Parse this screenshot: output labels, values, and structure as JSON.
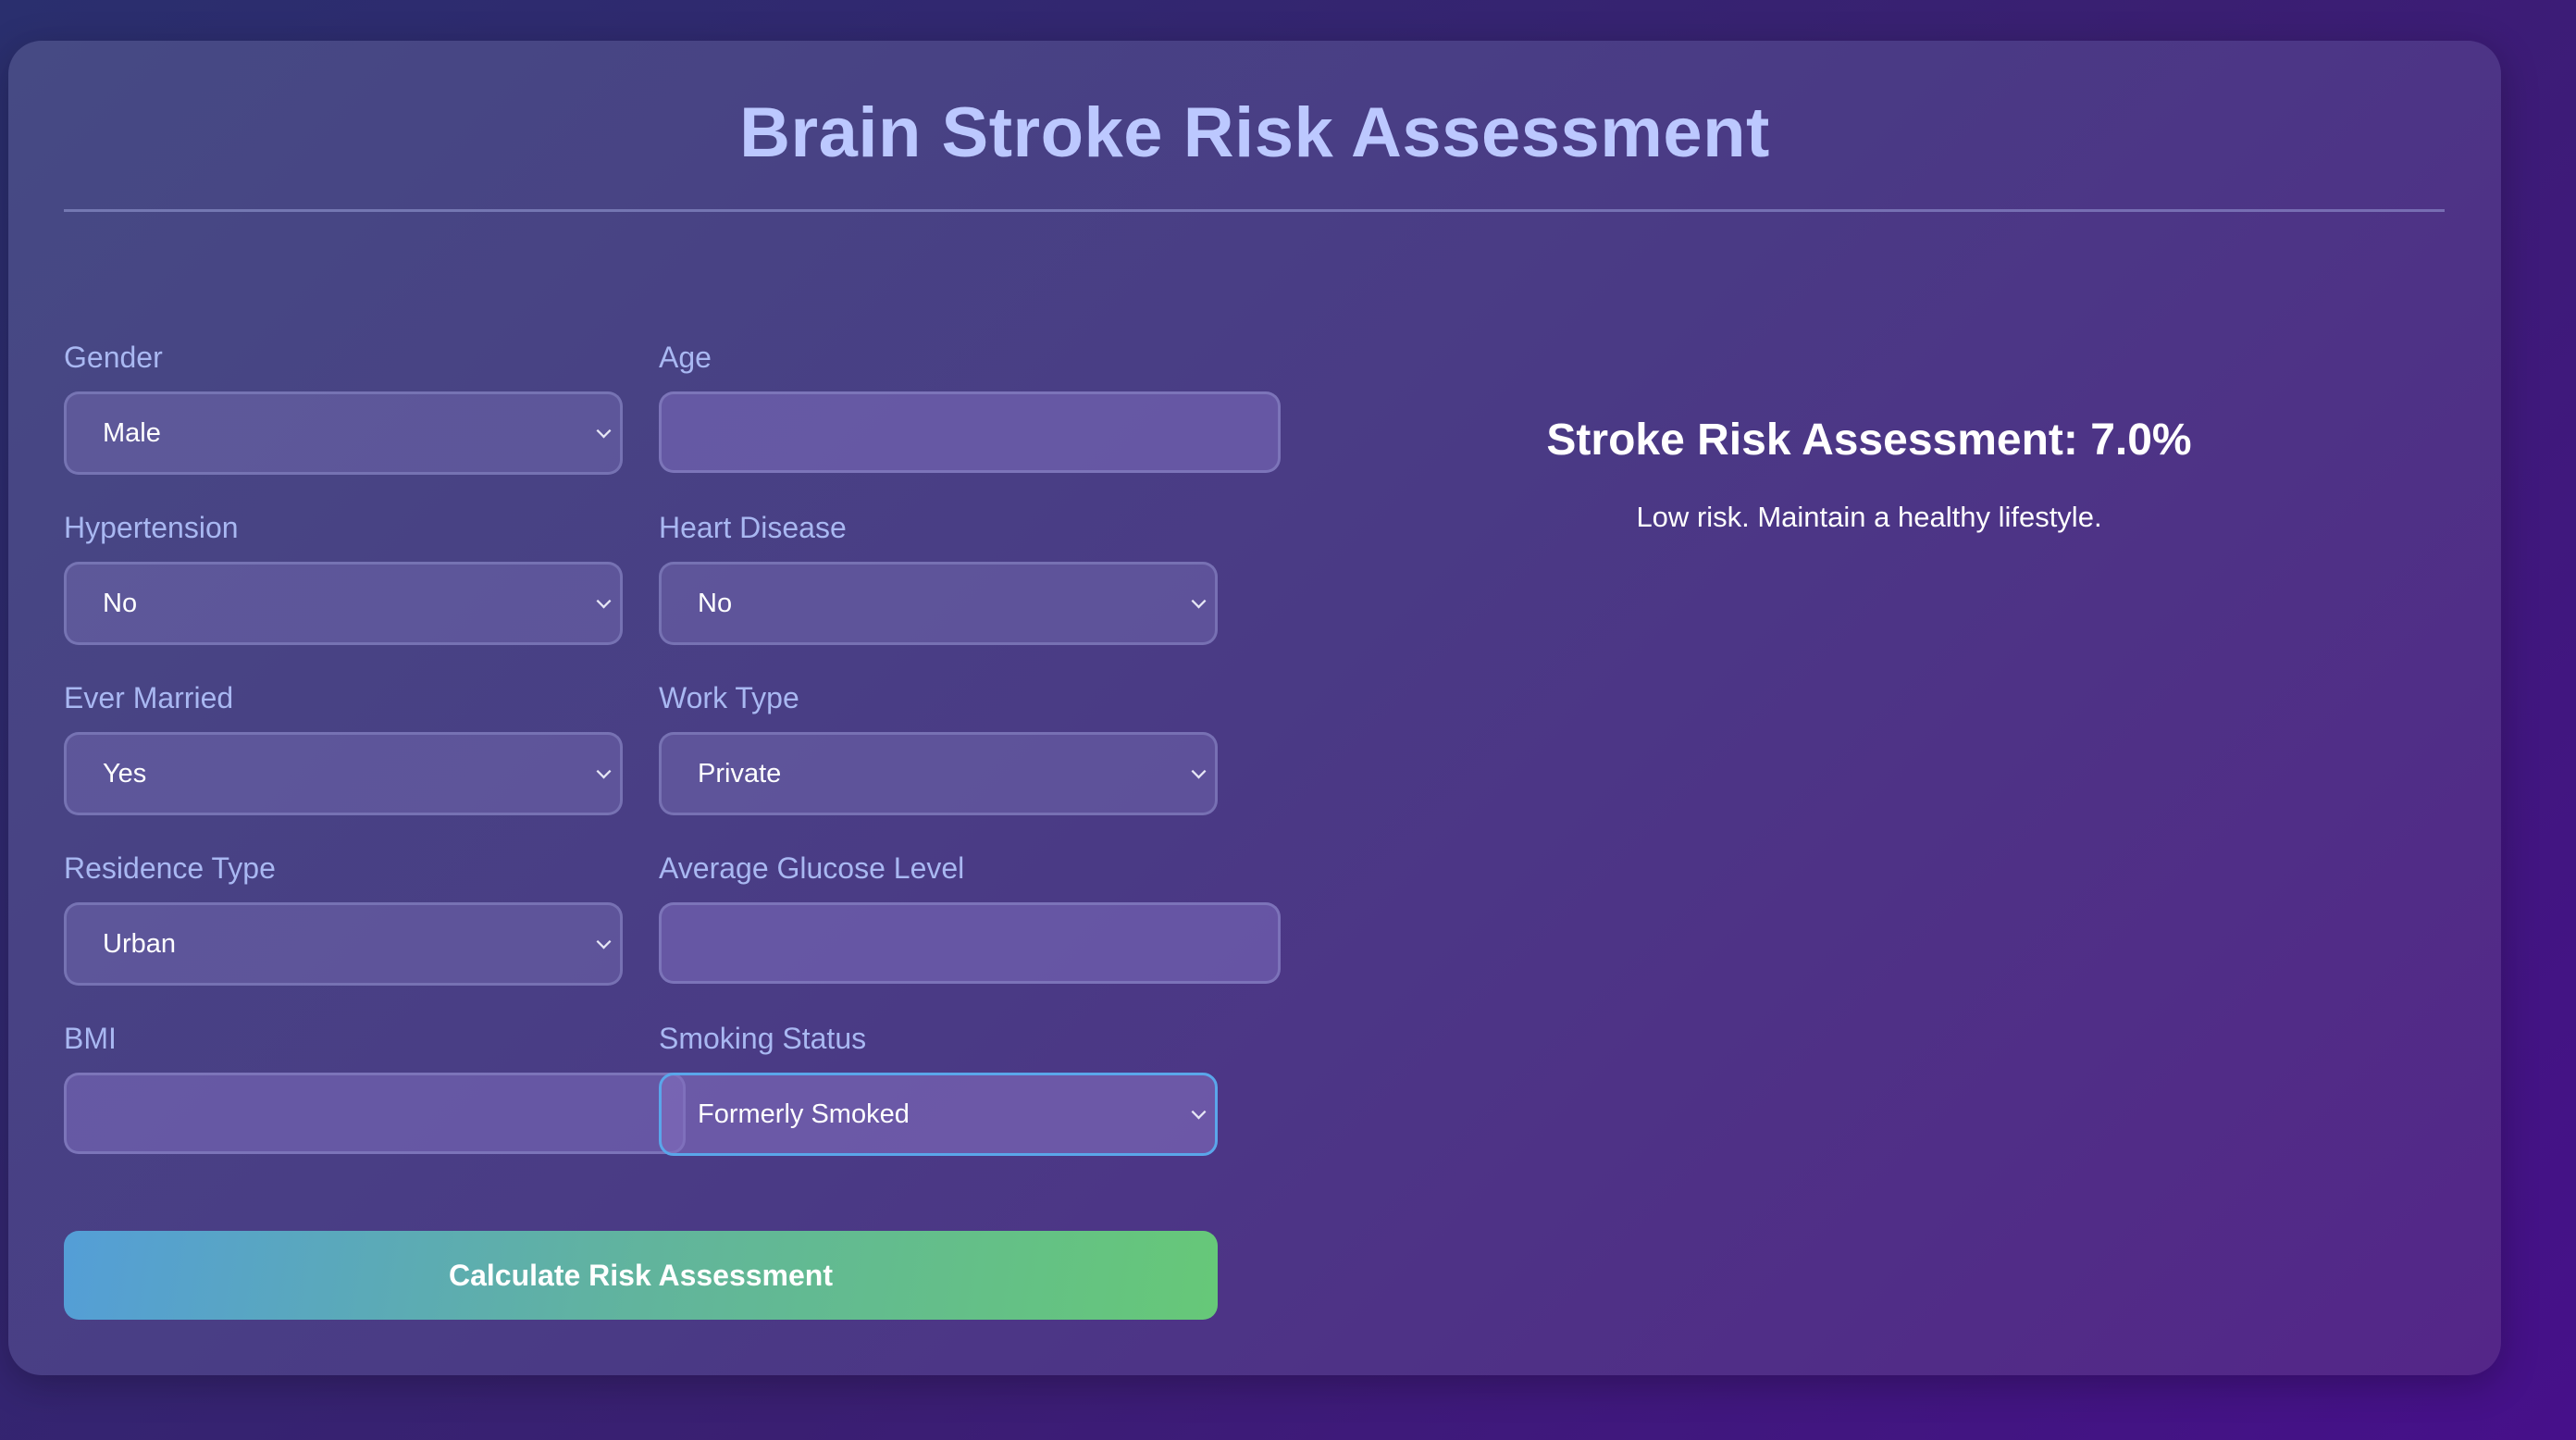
{
  "page": {
    "title": "Brain Stroke Risk Assessment"
  },
  "form": {
    "gender": {
      "label": "Gender",
      "value": "Male"
    },
    "age": {
      "label": "Age",
      "value": ""
    },
    "hypertension": {
      "label": "Hypertension",
      "value": "No"
    },
    "heart_disease": {
      "label": "Heart Disease",
      "value": "No"
    },
    "ever_married": {
      "label": "Ever Married",
      "value": "Yes"
    },
    "work_type": {
      "label": "Work Type",
      "value": "Private"
    },
    "residence_type": {
      "label": "Residence Type",
      "value": "Urban"
    },
    "avg_glucose": {
      "label": "Average Glucose Level",
      "value": ""
    },
    "bmi": {
      "label": "BMI",
      "value": ""
    },
    "smoking_status": {
      "label": "Smoking Status",
      "value": "Formerly Smoked"
    },
    "submit_label": "Calculate Risk Assessment"
  },
  "result": {
    "title": "Stroke Risk Assessment: 7.0%",
    "message": "Low risk. Maintain a healthy lifestyle."
  },
  "colors": {
    "title": "#bcc8ff",
    "label": "#a9b8f2",
    "focus_border": "#5aa6ea",
    "button_gradient_start": "#549ed7",
    "button_gradient_end": "#66c878"
  },
  "icons": {
    "select_arrow": "chevron-down-icon"
  }
}
